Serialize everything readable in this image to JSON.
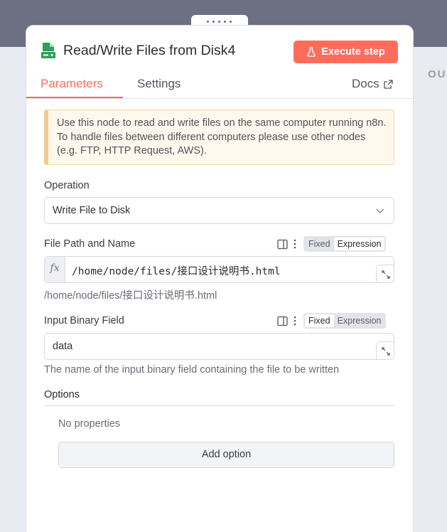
{
  "background": {
    "right_label": "OU"
  },
  "node": {
    "title": "Read/Write Files from Disk4",
    "icon": "file-disk-icon",
    "execute_label": "Execute step",
    "execute_icon": "flask-icon"
  },
  "tabs": [
    {
      "label": "Parameters",
      "active": true
    },
    {
      "label": "Settings",
      "active": false
    }
  ],
  "docs": {
    "label": "Docs",
    "icon": "external-link-icon"
  },
  "notice": {
    "text": "Use this node to read and write files on the same computer running n8n. To handle files between different computers please use other nodes (e.g. FTP, HTTP Request, AWS)."
  },
  "operation": {
    "label": "Operation",
    "value": "Write File to Disk"
  },
  "file_path": {
    "label": "File Path and Name",
    "mode_fixed": "Fixed",
    "mode_expression": "Expression",
    "active_mode": "Expression",
    "expression_prefix": "fx",
    "value": "/home/node/files/接口设计说明书.html",
    "preview": "/home/node/files/接口设计说明书.html"
  },
  "input_binary": {
    "label": "Input Binary Field",
    "mode_fixed": "Fixed",
    "mode_expression": "Expression",
    "active_mode": "Fixed",
    "value": "data",
    "hint": "The name of the input binary field containing the file to be written"
  },
  "options": {
    "label": "Options",
    "empty_text": "No properties",
    "add_label": "Add option"
  },
  "colors": {
    "accent": "#ff6d5a",
    "notice_border": "#f4c98a",
    "header_bg": "#6d6f82"
  }
}
